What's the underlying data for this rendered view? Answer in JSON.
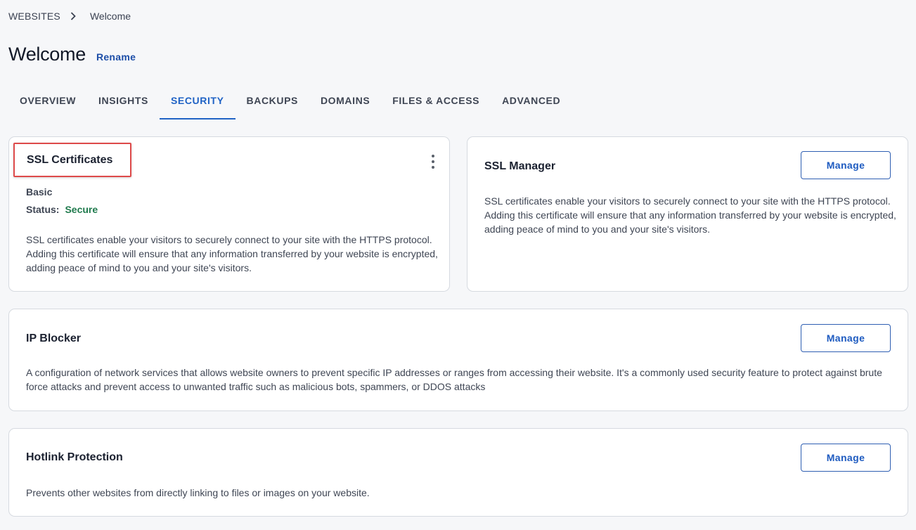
{
  "breadcrumb": {
    "root": "WEBSITES",
    "separator_icon": "chevron-right-icon",
    "current": "Welcome"
  },
  "header": {
    "title": "Welcome",
    "rename_label": "Rename"
  },
  "tabs": [
    {
      "label": "OVERVIEW",
      "active": false
    },
    {
      "label": "INSIGHTS",
      "active": false
    },
    {
      "label": "SECURITY",
      "active": true
    },
    {
      "label": "BACKUPS",
      "active": false
    },
    {
      "label": "DOMAINS",
      "active": false
    },
    {
      "label": "FILES & ACCESS",
      "active": false
    },
    {
      "label": "ADVANCED",
      "active": false
    }
  ],
  "ssl_certificates": {
    "title": "SSL Certificates",
    "plan": "Basic",
    "status_label": "Status:",
    "status_value": "Secure",
    "description": "SSL certificates enable your visitors to securely connect to your site with the HTTPS protocol. Adding this certificate will ensure that any information transferred by your website is encrypted, adding peace of mind to you and your site's visitors."
  },
  "ssl_manager": {
    "title": "SSL Manager",
    "button_label": "Manage",
    "description": "SSL certificates enable your visitors to securely connect to your site with the HTTPS protocol. Adding this certificate will ensure that any information transferred by your website is encrypted, adding peace of mind to you and your site's visitors."
  },
  "ip_blocker": {
    "title": "IP Blocker",
    "button_label": "Manage",
    "description": "A configuration of network services that allows website owners to prevent specific IP addresses or ranges from accessing their website. It's a commonly used security feature to protect against brute force attacks and prevent access to unwanted traffic such as malicious bots, spammers, or DDOS attacks"
  },
  "hotlink_protection": {
    "title": "Hotlink Protection",
    "button_label": "Manage",
    "description": "Prevents other websites from directly linking to files or images on your website."
  },
  "colors": {
    "accent": "#2063c5",
    "status_secure": "#1f7a4d",
    "highlight_border": "#de4a4a"
  }
}
